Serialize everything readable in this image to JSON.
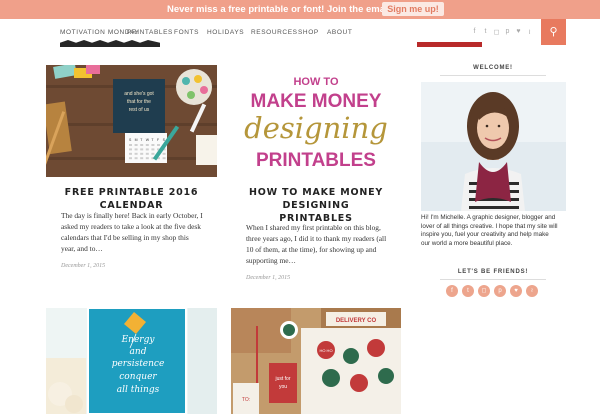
{
  "topbar": {
    "message": "Never miss a free printable or font! Join the email list.",
    "button": "Sign me up!"
  },
  "nav": {
    "items": [
      "MOTIVATION MONDAY",
      "PRINTABLES",
      "FONTS",
      "HOLIDAYS",
      "RESOURCES",
      "SHOP",
      "ABOUT"
    ],
    "social_icons": [
      "facebook-icon",
      "twitter-icon",
      "instagram-icon",
      "pinterest-icon",
      "heart-icon",
      "rss-icon"
    ],
    "search_icon": "search-icon"
  },
  "posts": [
    {
      "title": "FREE PRINTABLE 2016 CALENDAR",
      "excerpt_lines": [
        "The day is finally here! Back in early October, I",
        "asked my readers to take a look at the five desk",
        "calendars that I'd be selling in my shop this",
        "year, and to…"
      ],
      "date": "December 1, 2015",
      "image": {
        "card_text": [
          "and she's got",
          "that for the",
          "rest of us"
        ],
        "calendar_day_headers": [
          "S",
          "M",
          "T",
          "W",
          "T",
          "F",
          "S"
        ]
      }
    },
    {
      "title_lines": [
        "HOW TO MAKE MONEY DESIGNING",
        "PRINTABLES"
      ],
      "excerpt_lines": [
        "When I shared my first printable on this blog,",
        "three years ago, I did it to thank my readers (all",
        "10 of them, at the time), for showing up and",
        "supporting me…"
      ],
      "date": "December 1, 2015",
      "image": {
        "line1": "HOW TO",
        "line2": "MAKE MONEY",
        "line3": "designing",
        "line4": "PRINTABLES"
      }
    },
    {
      "image": {
        "script_lines": [
          "Energy",
          "and",
          "persistence",
          "conquer",
          "all things"
        ]
      }
    },
    {
      "image": {
        "box_label": "DELIVERY CO",
        "sticker_texts": [
          "just for",
          "you",
          "HO HO",
          "TO:"
        ]
      }
    }
  ],
  "sidebar": {
    "welcome_title": "WELCOME!",
    "bio_lines": [
      "Hi! I'm Michelle. A graphic designer, blogger and",
      "lover of all things creative. I hope that my site will",
      "inspire you, fuel your creativity and help make",
      "our world a more beautiful place."
    ],
    "friends_title": "LET'S BE FRIENDS!",
    "social_circles": [
      "facebook-icon",
      "twitter-icon",
      "instagram-icon",
      "pinterest-icon",
      "heart-icon",
      "rss-icon"
    ]
  },
  "colors": {
    "topbar": "#f0a08a",
    "accent": "#e87a5f",
    "magenta": "#c2408c",
    "gold": "#b5963a"
  }
}
